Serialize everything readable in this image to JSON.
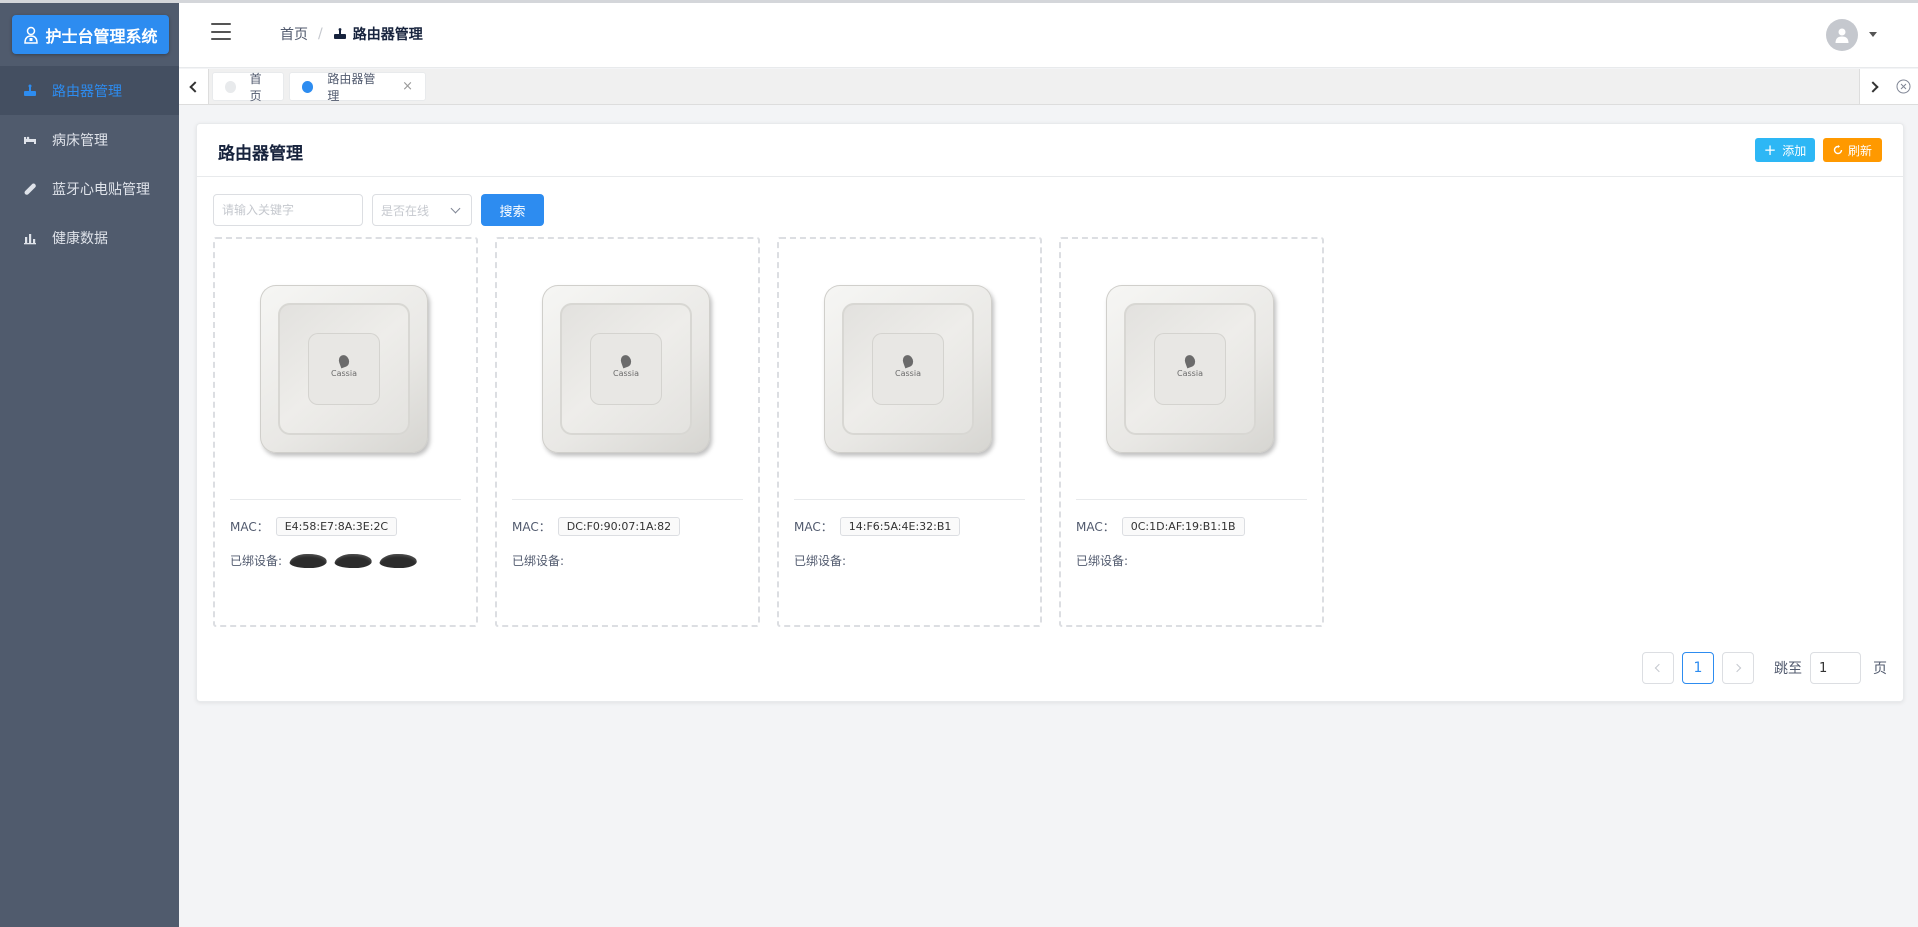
{
  "app": {
    "title": "护士台管理系统"
  },
  "sidebar": {
    "items": [
      {
        "label": "路由器管理",
        "icon": "router-icon",
        "active": true
      },
      {
        "label": "病床管理",
        "icon": "bed-icon",
        "active": false
      },
      {
        "label": "蓝牙心电贴管理",
        "icon": "bandage-icon",
        "active": false
      },
      {
        "label": "健康数据",
        "icon": "bar-chart-icon",
        "active": false
      }
    ]
  },
  "header": {
    "breadcrumb": {
      "home": "首页",
      "separator": "/",
      "current": "路由器管理"
    }
  },
  "tabs": [
    {
      "label": "首页",
      "active": false
    },
    {
      "label": "路由器管理",
      "active": true,
      "close": "×"
    }
  ],
  "page": {
    "title": "路由器管理",
    "add_label": "添加",
    "refresh_label": "刷新",
    "search": {
      "keyword_placeholder": "请输入关键字",
      "online_placeholder": "是否在线",
      "button_label": "搜索"
    }
  },
  "devices": [
    {
      "brand": "Cassia",
      "mac_label": "MAC：",
      "mac": "E4:58:E7:8A:3E:2C",
      "bound_label": "已绑设备:",
      "bound_count": 3
    },
    {
      "brand": "Cassia",
      "mac_label": "MAC：",
      "mac": "DC:F0:90:07:1A:82",
      "bound_label": "已绑设备:",
      "bound_count": 0
    },
    {
      "brand": "Cassia",
      "mac_label": "MAC：",
      "mac": "14:F6:5A:4E:32:B1",
      "bound_label": "已绑设备:",
      "bound_count": 0
    },
    {
      "brand": "Cassia",
      "mac_label": "MAC：",
      "mac": "0C:1D:AF:19:B1:1B",
      "bound_label": "已绑设备:",
      "bound_count": 0
    }
  ],
  "pagination": {
    "current_page": "1",
    "jump_label": "跳至",
    "jump_value": "1",
    "page_suffix": "页"
  },
  "colors": {
    "sidebar_bg": "#505b6d",
    "primary": "#2d8cf0",
    "info": "#2db7f5",
    "warning": "#ff9900"
  }
}
